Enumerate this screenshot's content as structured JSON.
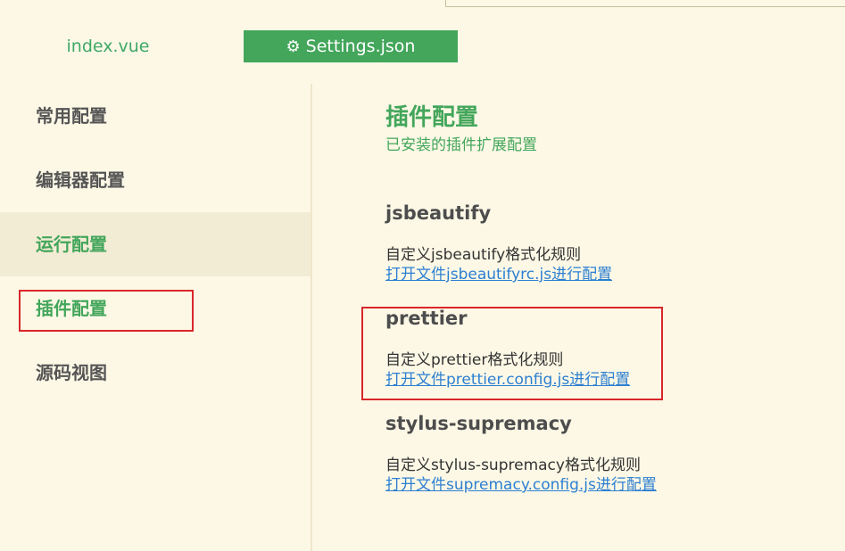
{
  "tabs": {
    "index_label": "index.vue",
    "settings_label": "Settings.json",
    "settings_icon": "gear-icon"
  },
  "sidebar": {
    "items": [
      {
        "label": "常用配置"
      },
      {
        "label": "编辑器配置"
      },
      {
        "label": "运行配置"
      },
      {
        "label": "插件配置"
      },
      {
        "label": "源码视图"
      }
    ]
  },
  "main": {
    "title": "插件配置",
    "subtitle": "已安装的插件扩展配置",
    "plugins": [
      {
        "name": "jsbeautify",
        "desc": "自定义jsbeautify格式化规则",
        "link": "打开文件jsbeautifyrc.js进行配置"
      },
      {
        "name": "prettier",
        "desc": "自定义prettier格式化规则",
        "link": "打开文件prettier.config.js进行配置"
      },
      {
        "name": "stylus-supremacy",
        "desc": "自定义stylus-supremacy格式化规则",
        "link": "打开文件supremacy.config.js进行配置"
      }
    ]
  },
  "colors": {
    "accent": "#43a65b",
    "background": "#fdf8e6",
    "highlight_box": "#d9262b",
    "link": "#2c7fd1"
  }
}
